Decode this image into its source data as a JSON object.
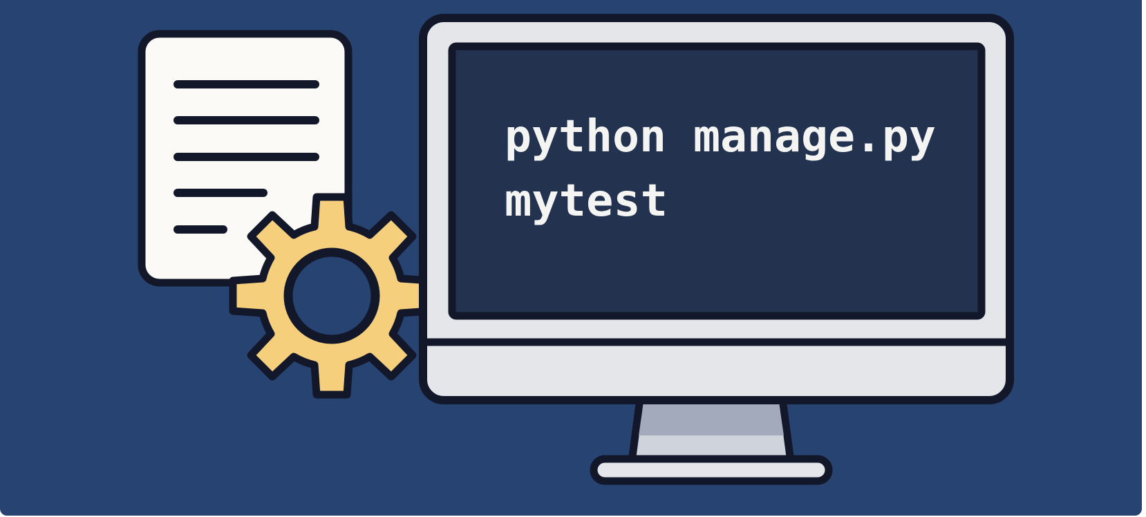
{
  "terminal": {
    "command_line_1": "python manage.py",
    "command_line_2": "mytest"
  },
  "icons": {
    "document": "document-icon",
    "gear": "gear-icon",
    "monitor": "monitor-icon"
  },
  "colors": {
    "background": "#274371",
    "outline": "#12182a",
    "screen": "#22324f",
    "monitor_body": "#e4e6ea",
    "document_paper": "#fbfaf6",
    "gear_fill": "#f6cf7c",
    "stand_top": "#a3aabb",
    "stand_bottom": "#cfd3dc",
    "text": "#f4f4f2"
  }
}
